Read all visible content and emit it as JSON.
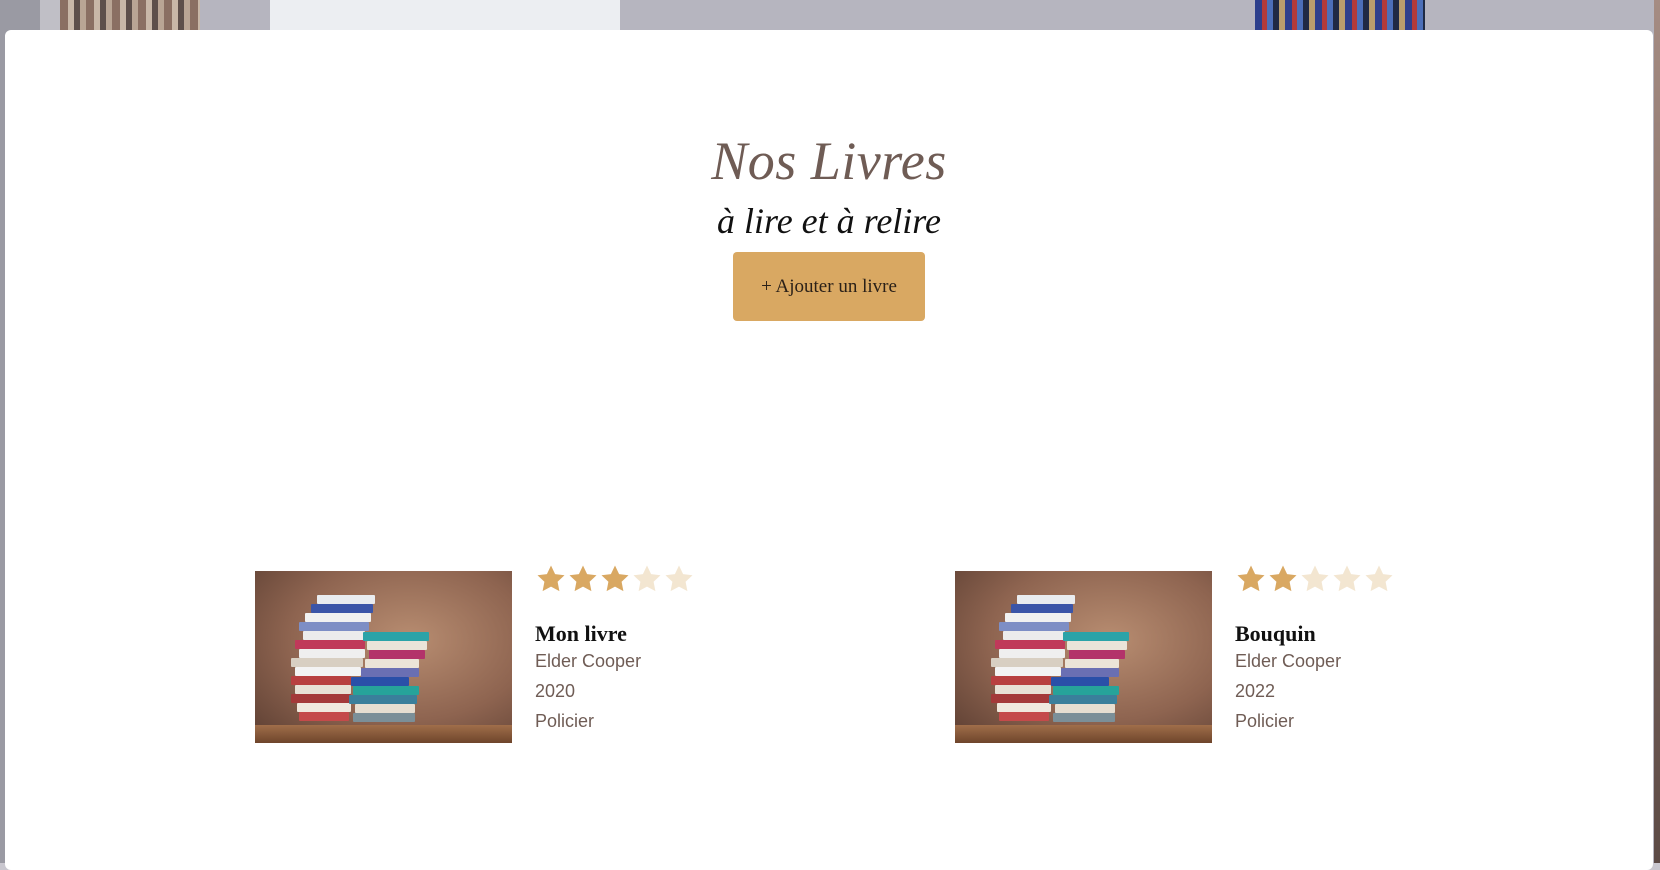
{
  "hero": {
    "title": "Nos Livres",
    "subtitle": "à lire et à relire",
    "add_button_label": "+ Ajouter un livre"
  },
  "colors": {
    "accent": "#d9a862",
    "star_filled": "#d9a862",
    "star_empty": "#f3e6d1",
    "meta_text": "#6f5c55"
  },
  "books": [
    {
      "title": "Mon livre",
      "author": "Elder Cooper",
      "year": "2020",
      "genre": "Policier",
      "rating": 3,
      "rating_max": 5,
      "image_icon": "book-stack-image"
    },
    {
      "title": "Bouquin",
      "author": "Elder Cooper",
      "year": "2022",
      "genre": "Policier",
      "rating": 2,
      "rating_max": 5,
      "image_icon": "book-stack-image"
    }
  ]
}
